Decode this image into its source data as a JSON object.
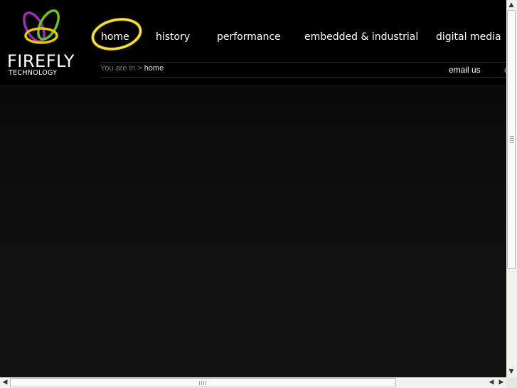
{
  "brand": {
    "name_line1": "FIREFLY",
    "name_line2": "TECHNOLOGY"
  },
  "nav": {
    "items": [
      {
        "label": "home",
        "active": true
      },
      {
        "label": "history"
      },
      {
        "label": "performance"
      },
      {
        "label": "embedded & industrial"
      },
      {
        "label": "digital media"
      }
    ]
  },
  "breadcrumb": {
    "prefix": "You are in >",
    "current": "home"
  },
  "header_links": {
    "email": "email us",
    "clipped": "c"
  },
  "scrollbar": {
    "up": "▲",
    "down": "▼",
    "left": "◀",
    "right": "▶"
  },
  "colors": {
    "background": "#000000",
    "accent_glow": "#f2d200",
    "logo_purple": "#9a2fb0",
    "logo_green": "#6fbf2a",
    "logo_yellow": "#e8c90a"
  }
}
